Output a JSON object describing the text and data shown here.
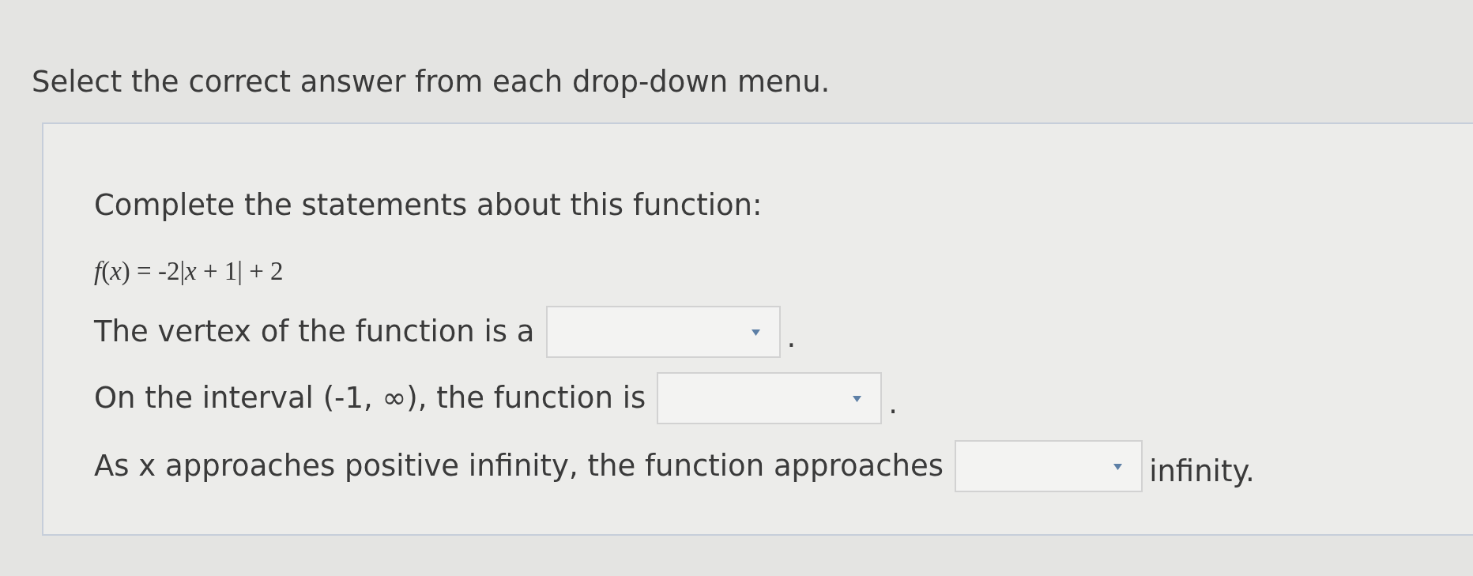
{
  "instruction": "Select the correct answer from each drop-down menu.",
  "question": {
    "prompt": "Complete the statements about this function:",
    "formula": "*f*(*x*) = -2|*x* + 1| + 2",
    "statements": [
      {
        "before": "The vertex of the function is a",
        "after": "."
      },
      {
        "before": "On the interval (-1, ∞), the function is",
        "after": "."
      },
      {
        "before": "As x approaches positive infinity, the function approaches",
        "after": "infinity."
      }
    ]
  }
}
